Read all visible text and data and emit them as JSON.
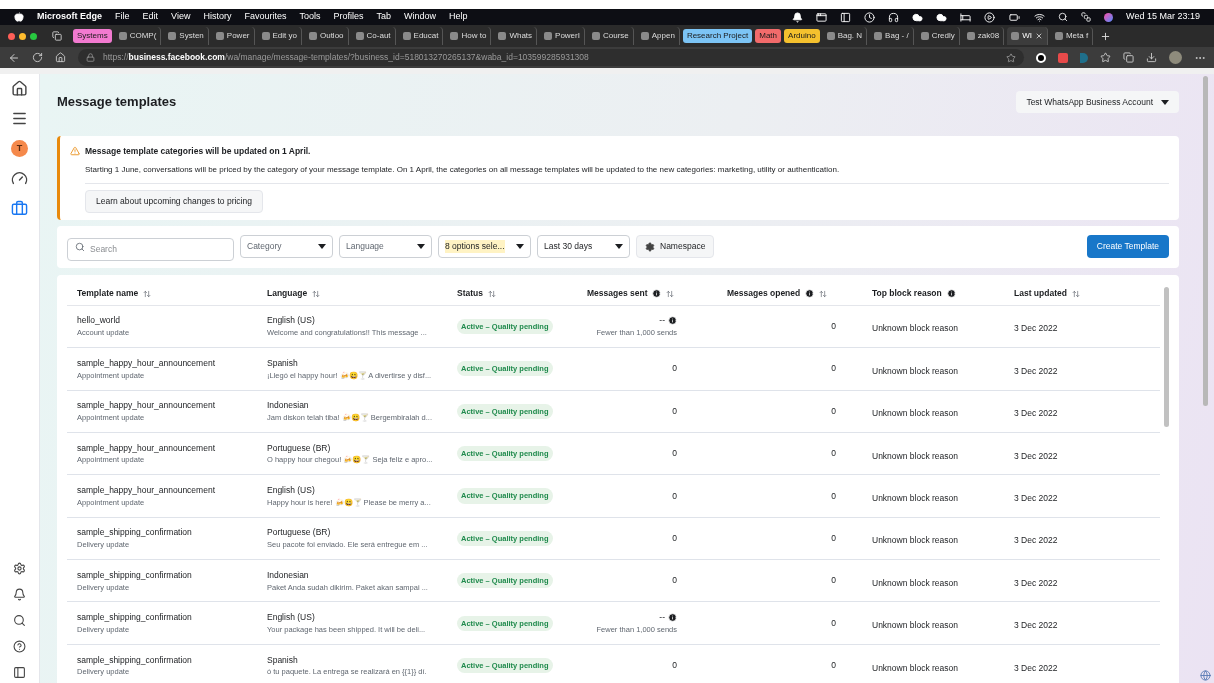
{
  "menu_bar": {
    "app": "Microsoft Edge",
    "items": [
      "File",
      "Edit",
      "View",
      "History",
      "Favourites",
      "Tools",
      "Profiles",
      "Tab",
      "Window",
      "Help"
    ],
    "clock": "Wed 15 Mar 23:19"
  },
  "tabs": [
    {
      "kind": "group",
      "label": "Systems",
      "color": "#f27ad0",
      "selected": false
    },
    {
      "kind": "tab",
      "label": "COMP(",
      "selected": false
    },
    {
      "kind": "tab",
      "label": "Systen",
      "selected": false
    },
    {
      "kind": "tab",
      "label": "Power",
      "selected": false
    },
    {
      "kind": "tab",
      "label": "Edit yo",
      "selected": false
    },
    {
      "kind": "tab",
      "label": "Outloo",
      "selected": false
    },
    {
      "kind": "tab",
      "label": "Co-aut",
      "selected": false
    },
    {
      "kind": "tab",
      "label": "Educat",
      "selected": false
    },
    {
      "kind": "tab",
      "label": "How to",
      "selected": false
    },
    {
      "kind": "tab",
      "label": "Whats",
      "selected": false
    },
    {
      "kind": "tab",
      "label": "PowerI",
      "selected": false
    },
    {
      "kind": "tab",
      "label": "Course",
      "selected": false
    },
    {
      "kind": "tab",
      "label": "Appen",
      "selected": false
    },
    {
      "kind": "group",
      "label": "Research Project",
      "color": "#7cc4f5",
      "selected": false
    },
    {
      "kind": "group",
      "label": "Math",
      "color": "#f26b6b",
      "selected": false
    },
    {
      "kind": "group",
      "label": "Arduino",
      "color": "#f5c12e",
      "selected": false
    },
    {
      "kind": "tab",
      "label": "Bag. N",
      "selected": false
    },
    {
      "kind": "tab",
      "label": "Bag - /",
      "selected": false
    },
    {
      "kind": "tab",
      "label": "Credly",
      "selected": false
    },
    {
      "kind": "tab",
      "label": "zak08",
      "selected": false
    },
    {
      "kind": "tab",
      "label": "WI",
      "selected": true
    },
    {
      "kind": "tab",
      "label": "Meta f",
      "selected": false
    }
  ],
  "address_bar": {
    "url": "https://**business.facebook.com**/wa/manage/message-templates/?business_id=518013270265137&waba_id=103599285931308"
  },
  "sidebar": {
    "avatar": "T",
    "items": [
      {
        "kind": "home",
        "selected": false
      },
      {
        "kind": "menu",
        "selected": false
      },
      {
        "kind": "gauge",
        "selected": false
      },
      {
        "kind": "briefcase",
        "selected": true
      }
    ]
  },
  "page": {
    "title": "Message templates",
    "account": "Test WhatsApp Business Account"
  },
  "notice": {
    "title": "Message template categories will be updated on 1 April.",
    "body": "Starting 1 June, conversations will be priced by the category of your message template. On 1 April, the categories on all message templates will be updated to the new categories: marketing, utility or authentication.",
    "button": "Learn about upcoming changes to pricing"
  },
  "filters": {
    "search_placeholder": "Search",
    "dropdowns": [
      {
        "label": "Category",
        "highlighted": false
      },
      {
        "label": "Language",
        "highlighted": false
      },
      {
        "label": "8 options sele...",
        "highlighted": true
      },
      {
        "label": "Last 30 days",
        "highlighted": false
      }
    ],
    "namespace": "Namespace",
    "create": "Create Template"
  },
  "table": {
    "columns": [
      {
        "label": "Template name",
        "info": false,
        "sortable": true
      },
      {
        "label": "Language",
        "info": false,
        "sortable": true
      },
      {
        "label": "Status",
        "info": false,
        "sortable": true
      },
      {
        "label": "Messages sent",
        "info": true,
        "sortable": true
      },
      {
        "label": "Messages opened",
        "info": true,
        "sortable": true
      },
      {
        "label": "Top block reason",
        "info": true,
        "sortable": false
      },
      {
        "label": "Last updated",
        "info": false,
        "sortable": true
      }
    ],
    "rows": [
      {
        "name": "hello_world",
        "category": "Account update",
        "language": "English (US)",
        "preview": "Welcome and congratulations!! This message ...",
        "status": "Active – Quality pending",
        "sent": "--",
        "sent_note": "Fewer than 1,000 sends",
        "opened": "0",
        "block_reason": "Unknown block reason",
        "updated": "3 Dec 2022"
      },
      {
        "name": "sample_happy_hour_announcement",
        "category": "Appointment update",
        "language": "Spanish",
        "preview": "¡Llegó el happy hour! 🍻😀🍸 A divertirse y disf...",
        "status": "Active – Quality pending",
        "sent": "0",
        "opened": "0",
        "block_reason": "Unknown block reason",
        "updated": "3 Dec 2022"
      },
      {
        "name": "sample_happy_hour_announcement",
        "category": "Appointment update",
        "language": "Indonesian",
        "preview": "Jam diskon telah tiba! 🍻😀🍸 Bergembiralah d...",
        "status": "Active – Quality pending",
        "sent": "0",
        "opened": "0",
        "block_reason": "Unknown block reason",
        "updated": "3 Dec 2022"
      },
      {
        "name": "sample_happy_hour_announcement",
        "category": "Appointment update",
        "language": "Portuguese (BR)",
        "preview": "O happy hour chegou! 🍻😀🍸 Seja feliz e apro...",
        "status": "Active – Quality pending",
        "sent": "0",
        "opened": "0",
        "block_reason": "Unknown block reason",
        "updated": "3 Dec 2022"
      },
      {
        "name": "sample_happy_hour_announcement",
        "category": "Appointment update",
        "language": "English (US)",
        "preview": "Happy hour is here! 🍻😀🍸 Please be merry a...",
        "status": "Active – Quality pending",
        "sent": "0",
        "opened": "0",
        "block_reason": "Unknown block reason",
        "updated": "3 Dec 2022"
      },
      {
        "name": "sample_shipping_confirmation",
        "category": "Delivery update",
        "language": "Portuguese (BR)",
        "preview": "Seu pacote foi enviado. Ele será entregue em ...",
        "status": "Active – Quality pending",
        "sent": "0",
        "opened": "0",
        "block_reason": "Unknown block reason",
        "updated": "3 Dec 2022"
      },
      {
        "name": "sample_shipping_confirmation",
        "category": "Delivery update",
        "language": "Indonesian",
        "preview": "Paket Anda sudah dikirim. Paket akan sampai ...",
        "status": "Active – Quality pending",
        "sent": "0",
        "opened": "0",
        "block_reason": "Unknown block reason",
        "updated": "3 Dec 2022"
      },
      {
        "name": "sample_shipping_confirmation",
        "category": "Delivery update",
        "language": "English (US)",
        "preview": "Your package has been shipped. It will be deli...",
        "status": "Active – Quality pending",
        "sent": "--",
        "sent_note": "Fewer than 1,000 sends",
        "opened": "0",
        "block_reason": "Unknown block reason",
        "updated": "3 Dec 2022"
      },
      {
        "name": "sample_shipping_confirmation",
        "category": "Delivery update",
        "language": "Spanish",
        "preview": "ó tu paquete. La entrega se realizará en {{1}} dí.",
        "status": "Active – Quality pending",
        "sent": "0",
        "opened": "0",
        "block_reason": "Unknown block reason",
        "updated": "3 Dec 2022"
      }
    ]
  }
}
